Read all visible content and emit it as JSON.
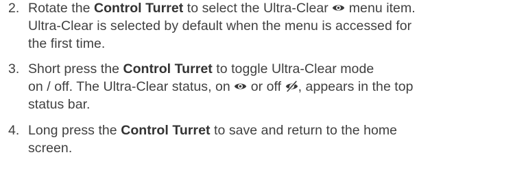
{
  "steps": [
    {
      "number": "2.",
      "lines": [
        {
          "a": "Rotate the ",
          "b": "Control Turret",
          "c": " to select the Ultra-Clear ",
          "icon": "eye-icon",
          "d": " menu item."
        },
        {
          "text": "Ultra-Clear is selected by default when the menu is accessed for"
        },
        {
          "text": "the first time."
        }
      ]
    },
    {
      "number": "3.",
      "lines": [
        {
          "a": "Short press the ",
          "b": "Control Turret",
          "c": " to toggle Ultra-Clear mode"
        },
        {
          "a": "on / off. The Ultra-Clear status, on ",
          "icon_on": "eye-icon",
          "b": " or off ",
          "icon_off": "eye-off-icon",
          "c": ", appears in the top"
        },
        {
          "text": "status bar."
        }
      ]
    },
    {
      "number": "4.",
      "lines": [
        {
          "a": "Long press the ",
          "b": "Control Turret",
          "c": " to save and return to the home"
        },
        {
          "text": "screen."
        }
      ]
    }
  ],
  "colors": {
    "text": "#404040",
    "bold": "#333333",
    "icon": "#3a3a3a"
  }
}
